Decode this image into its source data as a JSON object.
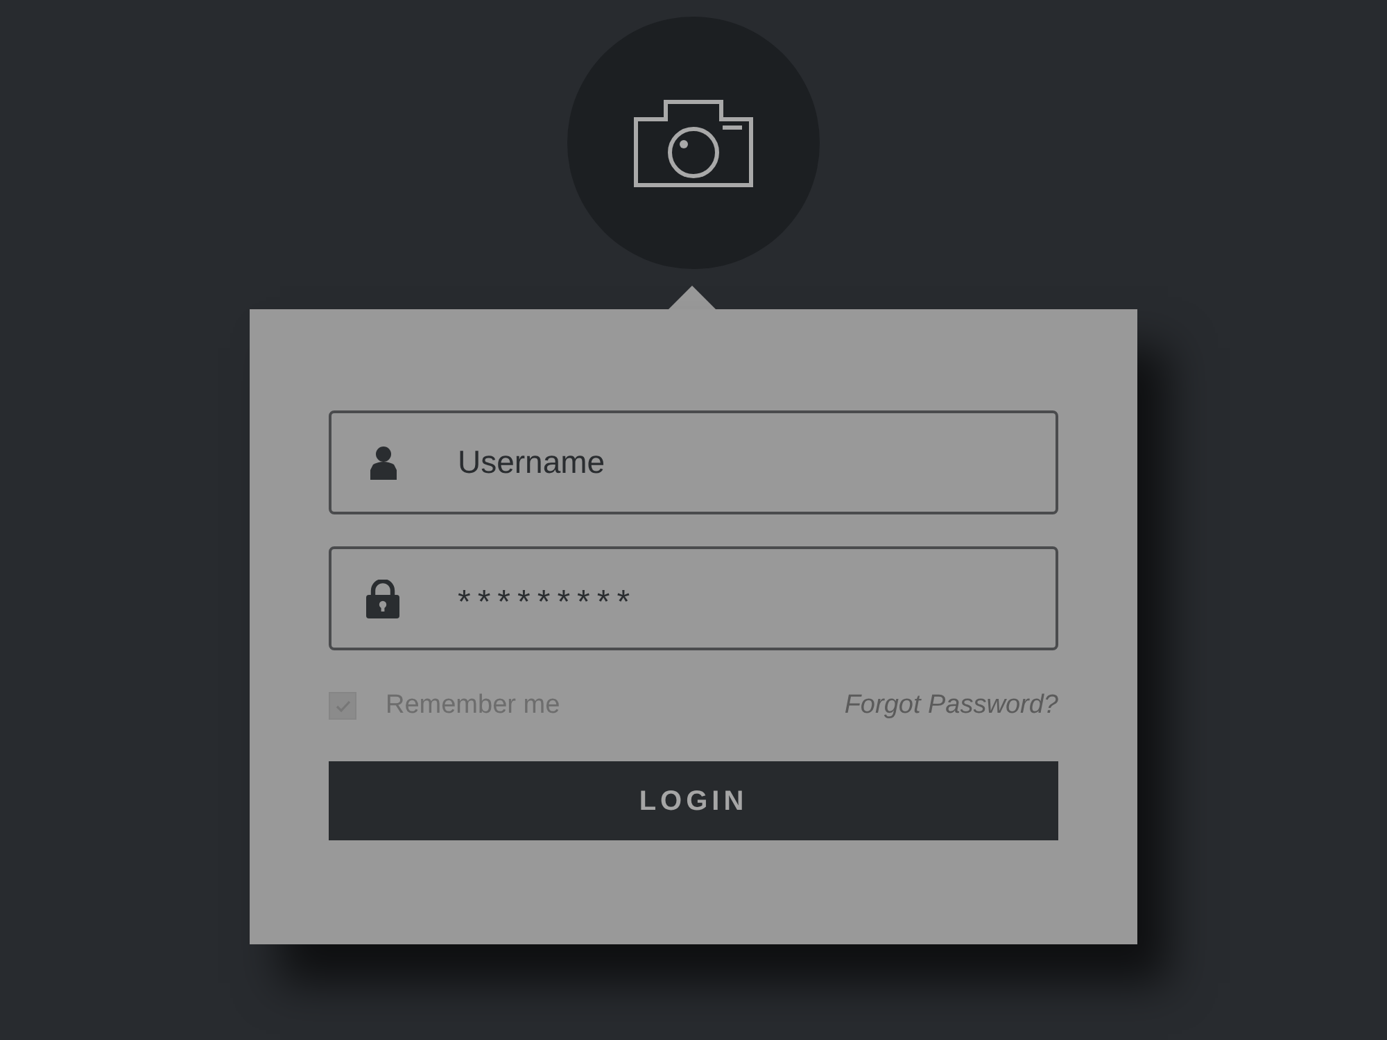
{
  "fields": [
    {
      "kind": "user",
      "value": "Username"
    },
    {
      "kind": "password",
      "value": "*********"
    }
  ],
  "remember": {
    "label": "Remember me",
    "checked": true
  },
  "forgot_link": "Forgot Password?",
  "login_button": "LOGIN"
}
